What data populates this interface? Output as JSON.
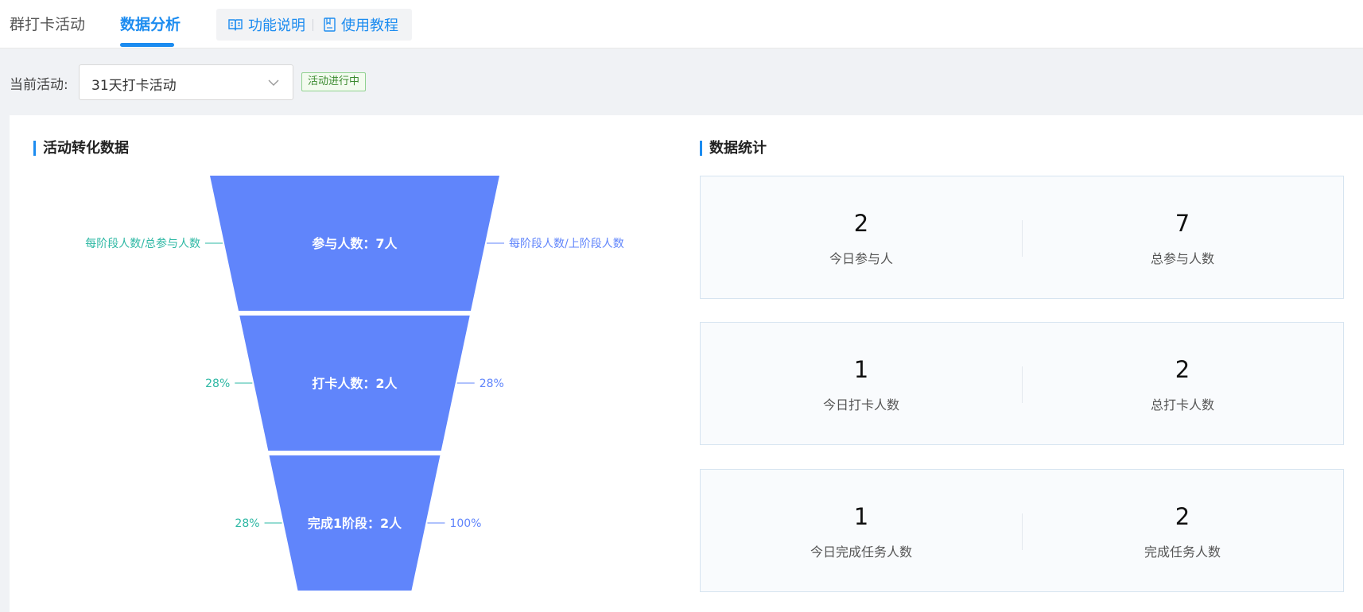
{
  "tabs": [
    {
      "label": "群打卡活动"
    },
    {
      "label": "数据分析"
    }
  ],
  "help": {
    "feature_label": "功能说明",
    "tutorial_label": "使用教程"
  },
  "activity": {
    "label": "当前活动:",
    "selected": "31天打卡活动",
    "status": "活动进行中"
  },
  "conversion": {
    "title": "活动转化数据",
    "left_axis_label": "每阶段人数/总参与人数",
    "right_axis_label": "每阶段人数/上阶段人数",
    "stage_color": "#6085fb",
    "left_color": "#2eb8a4",
    "right_color": "#6085fb"
  },
  "chart_data": {
    "type": "funnel",
    "stages": [
      {
        "label": "参与人数：7人",
        "value": 7,
        "pct_of_total": "",
        "pct_of_prev": ""
      },
      {
        "label": "打卡人数：2人",
        "value": 2,
        "pct_of_total": "28%",
        "pct_of_prev": "28%"
      },
      {
        "label": "完成1阶段：2人",
        "value": 2,
        "pct_of_total": "28%",
        "pct_of_prev": "100%"
      }
    ]
  },
  "stats": {
    "title": "数据统计",
    "cards": [
      {
        "left": {
          "value": "2",
          "label": "今日参与人"
        },
        "right": {
          "value": "7",
          "label": "总参与人数"
        }
      },
      {
        "left": {
          "value": "1",
          "label": "今日打卡人数"
        },
        "right": {
          "value": "2",
          "label": "总打卡人数"
        }
      },
      {
        "left": {
          "value": "1",
          "label": "今日完成任务人数"
        },
        "right": {
          "value": "2",
          "label": "完成任务人数"
        }
      }
    ]
  }
}
